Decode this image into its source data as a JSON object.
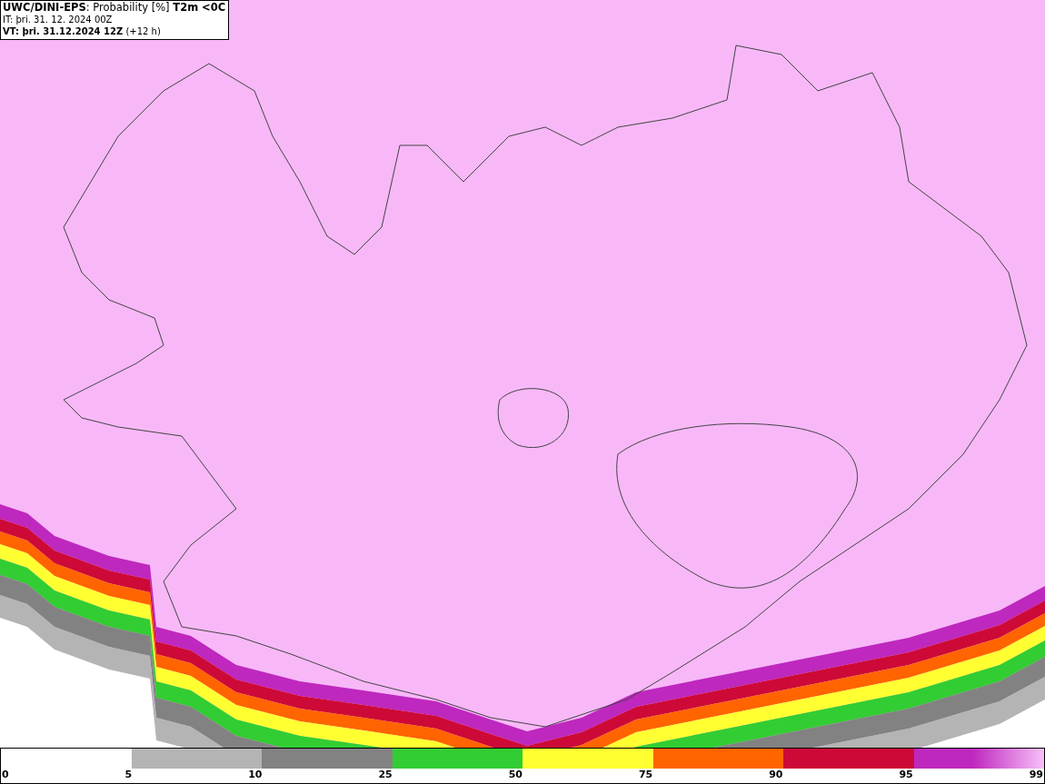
{
  "title_box": {
    "lines": [
      "**UWC/DINI-EPS**: Probability [%] **T2m <0C**",
      "IT: þri. 31. 12. 2024 00Z",
      "**VT: þri. 31.12.2024 12Z** (+12 h)"
    ]
  },
  "legend": {
    "segments": [
      {
        "kind": "blank"
      },
      {
        "color": "#b4b4b4",
        "kind": "solid"
      },
      {
        "color": "#828282",
        "kind": "solid"
      },
      {
        "color": "#32cd32",
        "kind": "solid"
      },
      {
        "color": "#ffff32",
        "kind": "solid"
      },
      {
        "color": "#ff6400",
        "kind": "solid"
      },
      {
        "color": "#cd0a37",
        "kind": "solid"
      },
      {
        "color": "#be28be",
        "kind": "gradient"
      }
    ],
    "labels": [
      "0",
      "5",
      "10",
      "25",
      "50",
      "75",
      "90",
      "95",
      "99"
    ]
  }
}
